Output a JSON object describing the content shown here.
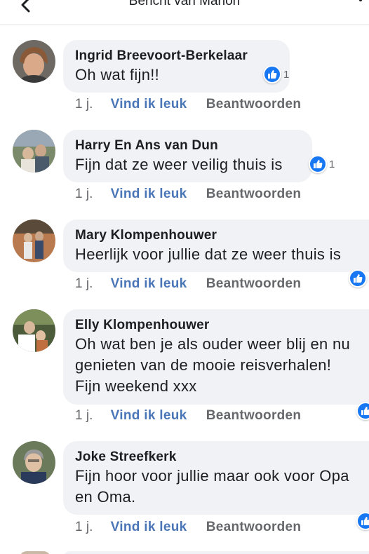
{
  "header": {
    "title": "Bericht van Marion"
  },
  "comments": [
    {
      "author": "Ingrid Breevoort-Berkelaar",
      "lines": [
        "Oh wat fijn!!"
      ],
      "time": "1 j.",
      "like_label": "Vind ik leuk",
      "reply_label": "Beantwoorden",
      "reaction_count": "1"
    },
    {
      "author": "Harry En Ans van Dun",
      "lines": [
        "Fijn dat ze weer veilig thuis is"
      ],
      "time": "1 j.",
      "like_label": "Vind ik leuk",
      "reply_label": "Beantwoorden",
      "reaction_count": "1"
    },
    {
      "author": "Mary Klompenhouwer",
      "lines": [
        "Heerlijk voor jullie dat ze weer thuis is"
      ],
      "time": "1 j.",
      "like_label": "Vind ik leuk",
      "reply_label": "Beantwoorden",
      "reaction_count": ""
    },
    {
      "author": "Elly Klompenhouwer",
      "lines": [
        "Oh wat ben je als ouder weer blij en nu",
        "genieten van de mooie reisverhalen!",
        "Fijn weekend xxx"
      ],
      "time": "1 j.",
      "like_label": "Vind ik leuk",
      "reply_label": "Beantwoorden",
      "reaction_count": ""
    },
    {
      "author": "Joke Streefkerk",
      "lines": [
        "Fijn hoor voor jullie maar ook voor Opa",
        "en Oma."
      ],
      "time": "1 j.",
      "like_label": "Vind ik leuk",
      "reply_label": "Beantwoorden",
      "reaction_count": ""
    }
  ],
  "icons": {
    "back": "chevron-left-icon",
    "more": "more-vertical-icon",
    "reaction": "thumbs-up-icon"
  },
  "colors": {
    "link": "#4a76b8",
    "like_badge": "#1877f2",
    "bubble": "#f0f2f5"
  }
}
